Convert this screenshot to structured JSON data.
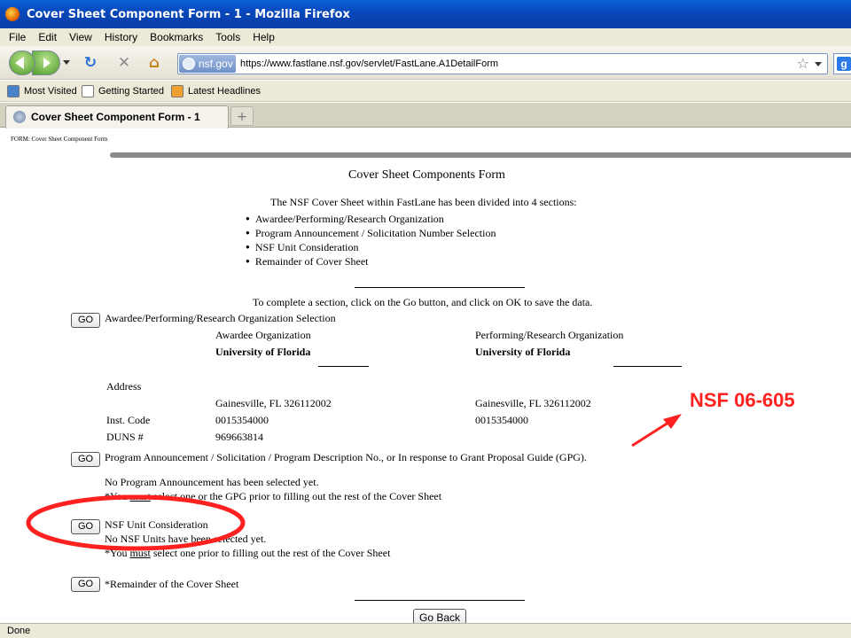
{
  "window": {
    "title": "Cover Sheet Component Form - 1 - Mozilla Firefox"
  },
  "menu": [
    "File",
    "Edit",
    "View",
    "History",
    "Bookmarks",
    "Tools",
    "Help"
  ],
  "navbar": {
    "site_identity": "nsf.gov",
    "url": "https://www.fastlane.nsf.gov/servlet/FastLane.A1DetailForm",
    "search_engine_icon": "google-g"
  },
  "bookmarks": [
    "Most Visited",
    "Getting Started",
    "Latest Headlines"
  ],
  "tab": {
    "title": "Cover Sheet Component Form - 1",
    "new_tab_symbol": "+"
  },
  "form": {
    "label": "FORM: Cover Sheet Component Form",
    "title": "Cover Sheet Components Form",
    "intro": "The NSF Cover Sheet within FastLane has been divided into 4 sections:",
    "sections": [
      "Awardee/Performing/Research Organization",
      "Program Announcement / Solicitation Number Selection",
      "NSF Unit Consideration",
      "Remainder of Cover Sheet"
    ],
    "instruction": "To complete a section, click on the Go button, and click on OK to save the data.",
    "go_label": "GO",
    "org": {
      "heading": "Awardee/Performing/Research Organization Selection",
      "awardee_col": "Awardee Organization",
      "performing_col": "Performing/Research Organization",
      "awardee_name": "University of Florida",
      "performing_name": "University of Florida",
      "address_label": "Address",
      "awardee_city": "Gainesville, FL 326112002",
      "performing_city": "Gainesville, FL 326112002",
      "inst_code_label": "Inst. Code",
      "awardee_inst_code": "0015354000",
      "performing_inst_code": "0015354000",
      "duns_label": "DUNS #",
      "awardee_duns": "969663814"
    },
    "program": {
      "heading": "Program Announcement / Solicitation / Program Description No., or In response to Grant Proposal Guide (GPG).",
      "status": "No Program Announcement has been selected yet.",
      "note_pre": "*You ",
      "note_must": "must",
      "note_post": " select one or the GPG prior to filling out the rest of the Cover Sheet"
    },
    "nsf_unit": {
      "heading": "NSF Unit Consideration",
      "status": "No NSF Units have been selected yet.",
      "note_pre": "*You ",
      "note_must": "must",
      "note_post": " select one prior to filling out the rest of the Cover Sheet"
    },
    "remainder": {
      "heading": "*Remainder of the Cover Sheet"
    },
    "go_back_label": "Go Back"
  },
  "annotation": {
    "label": "NSF 06-605",
    "color": "#ff2020"
  },
  "status": {
    "text": "Done"
  }
}
